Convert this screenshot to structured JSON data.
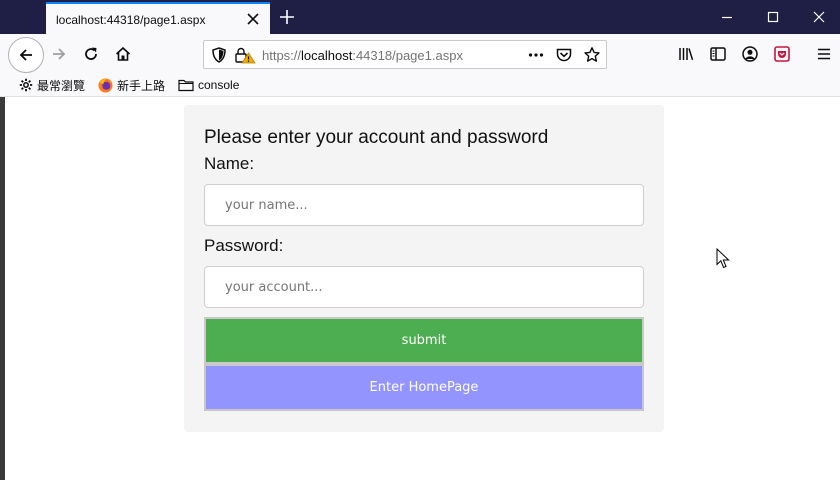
{
  "tab": {
    "title": "localhost:44318/page1.aspx"
  },
  "urlbar": {
    "scheme": "https://",
    "host": "localhost",
    "rest": ":44318/page1.aspx"
  },
  "bookmarks": [
    {
      "label": "最常瀏覽",
      "icon": "gear-icon"
    },
    {
      "label": "新手上路",
      "icon": "firefox-icon"
    },
    {
      "label": "console",
      "icon": "folder-icon"
    }
  ],
  "form": {
    "heading": "Please enter your account and password",
    "name_label": "Name:",
    "name_placeholder": "your name...",
    "password_label": "Password:",
    "password_placeholder": "your account...",
    "submit_label": "submit",
    "homepage_label": "Enter HomePage"
  },
  "colors": {
    "tabstrip": "#1f1e45",
    "accent": "#0a84ff",
    "submit_button": "#4cae51",
    "homepage_button": "#9494ff",
    "card": "#f4f4f4"
  }
}
